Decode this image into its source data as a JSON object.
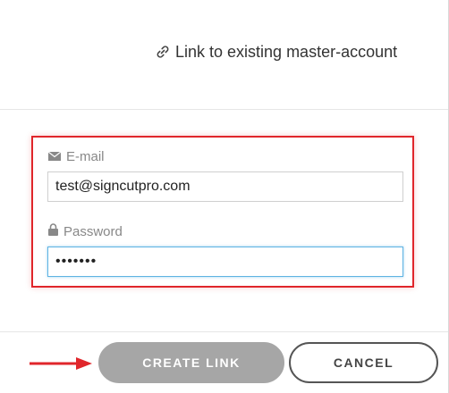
{
  "header": {
    "title": "Link to existing master-account",
    "icon": "link-icon"
  },
  "form": {
    "email": {
      "label": "E-mail",
      "icon": "envelope-icon",
      "value": "test@signcutpro.com"
    },
    "password": {
      "label": "Password",
      "icon": "lock-icon",
      "value": "•••••••"
    },
    "highlight_color": "#e0262b"
  },
  "footer": {
    "create_label": "CREATE LINK",
    "cancel_label": "CANCEL",
    "annotation_arrow_color": "#e0262b"
  }
}
